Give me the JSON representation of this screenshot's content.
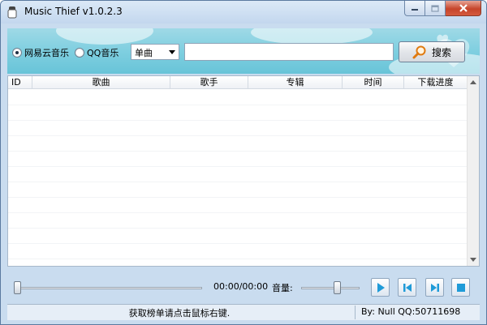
{
  "window": {
    "title": "Music Thief  v1.0.2.3"
  },
  "toolbar": {
    "source_options": [
      {
        "label": "网易云音乐",
        "selected": true
      },
      {
        "label": "QQ音乐",
        "selected": false
      }
    ],
    "search_type": "单曲",
    "search_query": "",
    "search_button": "搜索"
  },
  "table": {
    "columns": [
      "ID",
      "歌曲",
      "歌手",
      "专辑",
      "时间",
      "下载进度"
    ],
    "rows": []
  },
  "player": {
    "time_display": "00:00/00:00",
    "volume_label": "音量:",
    "seek_position": 0,
    "volume_level": 0.5
  },
  "status": {
    "message": "获取榜单请点击鼠标右键.",
    "credit": "By: Null   QQ:50711698"
  },
  "colors": {
    "toolbar_sky": "#7fcfe0",
    "play_icon": "#1f9bd8"
  }
}
